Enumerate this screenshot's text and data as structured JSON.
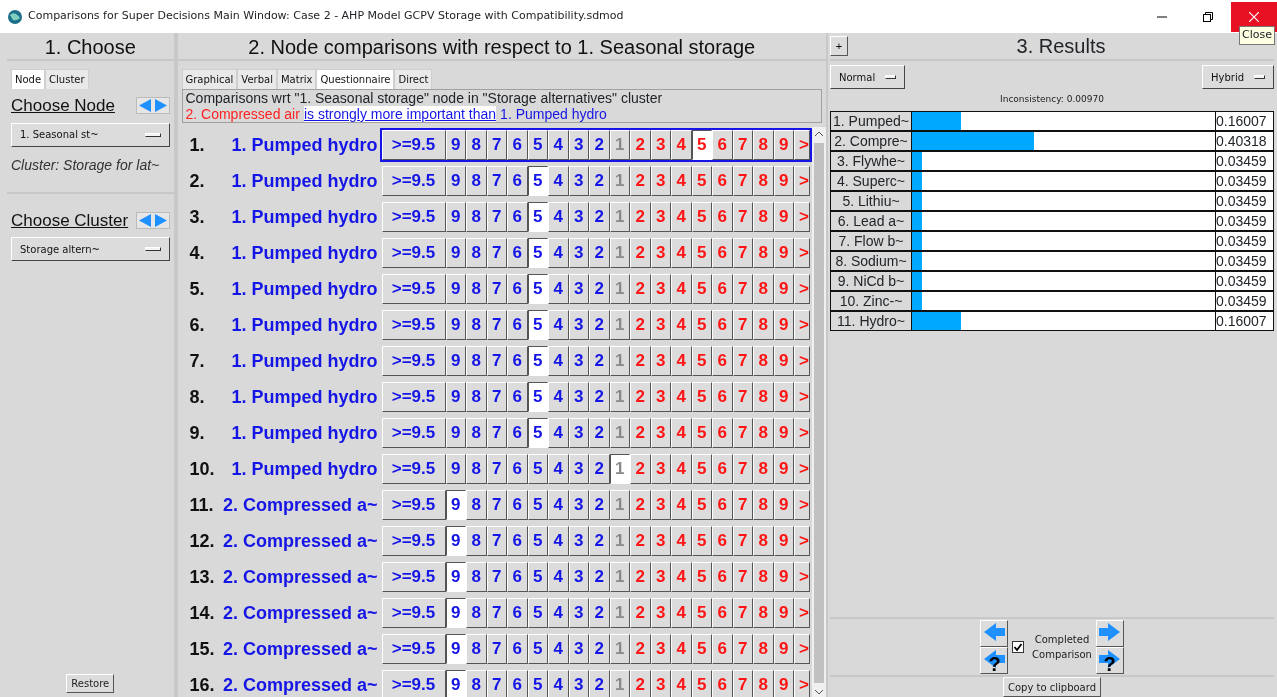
{
  "window": {
    "title": "Comparisons for Super Decisions Main Window: Case 2 - AHP Model GCPV Storage with Compatibility.sdmod",
    "tooltip": "Close"
  },
  "choose": {
    "title": "1. Choose",
    "tabs": [
      {
        "label": "Node",
        "selected": true
      },
      {
        "label": "Cluster",
        "selected": false
      }
    ],
    "node_heading": "Choose Node",
    "node_value": "1. Seasonal st~",
    "cluster_info": "Cluster: Storage for lat~",
    "cluster_heading": "Choose Cluster",
    "cluster_value": "Storage altern~",
    "restore": "Restore"
  },
  "comparisons": {
    "title": "2. Node comparisons with respect to 1. Seasonal storage",
    "tabs": [
      {
        "label": "Graphical",
        "selected": false
      },
      {
        "label": "Verbal",
        "selected": false
      },
      {
        "label": "Matrix",
        "selected": false
      },
      {
        "label": "Questionnaire",
        "selected": true
      },
      {
        "label": "Direct",
        "selected": false
      }
    ],
    "description": "Comparisons wrt \"1. Seasonal storage\" node in \"Storage alternatives\" cluster",
    "judgment": {
      "winner": "2. Compressed air",
      "phrase": "is strongly more important than",
      "loser": "1. Pumped hydro"
    },
    "rows": [
      {
        "number": "1.",
        "item": "1. Pumped hydro",
        "active": true,
        "cells": [
          {
            "text": ">=9.5",
            "kind": "top",
            "selected": false
          },
          {
            "text": "9",
            "kind": "left",
            "selected": false
          },
          {
            "text": "8",
            "kind": "left",
            "selected": false
          },
          {
            "text": "7",
            "kind": "left",
            "selected": false
          },
          {
            "text": "6",
            "kind": "left",
            "selected": false
          },
          {
            "text": "5",
            "kind": "left",
            "selected": false
          },
          {
            "text": "4",
            "kind": "left",
            "selected": false
          },
          {
            "text": "3",
            "kind": "left",
            "selected": false
          },
          {
            "text": "2",
            "kind": "left",
            "selected": false
          },
          {
            "text": "1",
            "kind": "equal",
            "selected": false
          },
          {
            "text": "2",
            "kind": "right",
            "selected": false
          },
          {
            "text": "3",
            "kind": "right",
            "selected": false
          },
          {
            "text": "4",
            "kind": "right",
            "selected": false
          },
          {
            "text": "5",
            "kind": "right",
            "selected": true
          },
          {
            "text": "6",
            "kind": "right",
            "selected": false
          },
          {
            "text": "7",
            "kind": "right",
            "selected": false
          },
          {
            "text": "8",
            "kind": "right",
            "selected": false
          },
          {
            "text": "9",
            "kind": "right",
            "selected": false
          },
          {
            "text": ">",
            "kind": "more",
            "selected": false
          }
        ]
      },
      {
        "number": "2.",
        "item": "1. Pumped hydro",
        "active": false,
        "cells": [
          {
            "text": ">=9.5",
            "kind": "top",
            "selected": false
          },
          {
            "text": "9",
            "kind": "left",
            "selected": false
          },
          {
            "text": "8",
            "kind": "left",
            "selected": false
          },
          {
            "text": "7",
            "kind": "left",
            "selected": false
          },
          {
            "text": "6",
            "kind": "left",
            "selected": false
          },
          {
            "text": "5",
            "kind": "left",
            "selected": true
          },
          {
            "text": "4",
            "kind": "left",
            "selected": false
          },
          {
            "text": "3",
            "kind": "left",
            "selected": false
          },
          {
            "text": "2",
            "kind": "left",
            "selected": false
          },
          {
            "text": "1",
            "kind": "equal",
            "selected": false
          },
          {
            "text": "2",
            "kind": "right",
            "selected": false
          },
          {
            "text": "3",
            "kind": "right",
            "selected": false
          },
          {
            "text": "4",
            "kind": "right",
            "selected": false
          },
          {
            "text": "5",
            "kind": "right",
            "selected": false
          },
          {
            "text": "6",
            "kind": "right",
            "selected": false
          },
          {
            "text": "7",
            "kind": "right",
            "selected": false
          },
          {
            "text": "8",
            "kind": "right",
            "selected": false
          },
          {
            "text": "9",
            "kind": "right",
            "selected": false
          },
          {
            "text": ">",
            "kind": "more",
            "selected": false
          }
        ]
      },
      {
        "number": "3.",
        "item": "1. Pumped hydro",
        "active": false,
        "cells": [
          {
            "text": ">=9.5",
            "kind": "top",
            "selected": false
          },
          {
            "text": "9",
            "kind": "left",
            "selected": false
          },
          {
            "text": "8",
            "kind": "left",
            "selected": false
          },
          {
            "text": "7",
            "kind": "left",
            "selected": false
          },
          {
            "text": "6",
            "kind": "left",
            "selected": false
          },
          {
            "text": "5",
            "kind": "left",
            "selected": true
          },
          {
            "text": "4",
            "kind": "left",
            "selected": false
          },
          {
            "text": "3",
            "kind": "left",
            "selected": false
          },
          {
            "text": "2",
            "kind": "left",
            "selected": false
          },
          {
            "text": "1",
            "kind": "equal",
            "selected": false
          },
          {
            "text": "2",
            "kind": "right",
            "selected": false
          },
          {
            "text": "3",
            "kind": "right",
            "selected": false
          },
          {
            "text": "4",
            "kind": "right",
            "selected": false
          },
          {
            "text": "5",
            "kind": "right",
            "selected": false
          },
          {
            "text": "6",
            "kind": "right",
            "selected": false
          },
          {
            "text": "7",
            "kind": "right",
            "selected": false
          },
          {
            "text": "8",
            "kind": "right",
            "selected": false
          },
          {
            "text": "9",
            "kind": "right",
            "selected": false
          },
          {
            "text": ">",
            "kind": "more",
            "selected": false
          }
        ]
      },
      {
        "number": "4.",
        "item": "1. Pumped hydro",
        "active": false,
        "cells": [
          {
            "text": ">=9.5",
            "kind": "top",
            "selected": false
          },
          {
            "text": "9",
            "kind": "left",
            "selected": false
          },
          {
            "text": "8",
            "kind": "left",
            "selected": false
          },
          {
            "text": "7",
            "kind": "left",
            "selected": false
          },
          {
            "text": "6",
            "kind": "left",
            "selected": false
          },
          {
            "text": "5",
            "kind": "left",
            "selected": true
          },
          {
            "text": "4",
            "kind": "left",
            "selected": false
          },
          {
            "text": "3",
            "kind": "left",
            "selected": false
          },
          {
            "text": "2",
            "kind": "left",
            "selected": false
          },
          {
            "text": "1",
            "kind": "equal",
            "selected": false
          },
          {
            "text": "2",
            "kind": "right",
            "selected": false
          },
          {
            "text": "3",
            "kind": "right",
            "selected": false
          },
          {
            "text": "4",
            "kind": "right",
            "selected": false
          },
          {
            "text": "5",
            "kind": "right",
            "selected": false
          },
          {
            "text": "6",
            "kind": "right",
            "selected": false
          },
          {
            "text": "7",
            "kind": "right",
            "selected": false
          },
          {
            "text": "8",
            "kind": "right",
            "selected": false
          },
          {
            "text": "9",
            "kind": "right",
            "selected": false
          },
          {
            "text": ">",
            "kind": "more",
            "selected": false
          }
        ]
      },
      {
        "number": "5.",
        "item": "1. Pumped hydro",
        "active": false,
        "cells": [
          {
            "text": ">=9.5",
            "kind": "top",
            "selected": false
          },
          {
            "text": "9",
            "kind": "left",
            "selected": false
          },
          {
            "text": "8",
            "kind": "left",
            "selected": false
          },
          {
            "text": "7",
            "kind": "left",
            "selected": false
          },
          {
            "text": "6",
            "kind": "left",
            "selected": false
          },
          {
            "text": "5",
            "kind": "left",
            "selected": true
          },
          {
            "text": "4",
            "kind": "left",
            "selected": false
          },
          {
            "text": "3",
            "kind": "left",
            "selected": false
          },
          {
            "text": "2",
            "kind": "left",
            "selected": false
          },
          {
            "text": "1",
            "kind": "equal",
            "selected": false
          },
          {
            "text": "2",
            "kind": "right",
            "selected": false
          },
          {
            "text": "3",
            "kind": "right",
            "selected": false
          },
          {
            "text": "4",
            "kind": "right",
            "selected": false
          },
          {
            "text": "5",
            "kind": "right",
            "selected": false
          },
          {
            "text": "6",
            "kind": "right",
            "selected": false
          },
          {
            "text": "7",
            "kind": "right",
            "selected": false
          },
          {
            "text": "8",
            "kind": "right",
            "selected": false
          },
          {
            "text": "9",
            "kind": "right",
            "selected": false
          },
          {
            "text": ">",
            "kind": "more",
            "selected": false
          }
        ]
      },
      {
        "number": "6.",
        "item": "1. Pumped hydro",
        "active": false,
        "cells": [
          {
            "text": ">=9.5",
            "kind": "top",
            "selected": false
          },
          {
            "text": "9",
            "kind": "left",
            "selected": false
          },
          {
            "text": "8",
            "kind": "left",
            "selected": false
          },
          {
            "text": "7",
            "kind": "left",
            "selected": false
          },
          {
            "text": "6",
            "kind": "left",
            "selected": false
          },
          {
            "text": "5",
            "kind": "left",
            "selected": true
          },
          {
            "text": "4",
            "kind": "left",
            "selected": false
          },
          {
            "text": "3",
            "kind": "left",
            "selected": false
          },
          {
            "text": "2",
            "kind": "left",
            "selected": false
          },
          {
            "text": "1",
            "kind": "equal",
            "selected": false
          },
          {
            "text": "2",
            "kind": "right",
            "selected": false
          },
          {
            "text": "3",
            "kind": "right",
            "selected": false
          },
          {
            "text": "4",
            "kind": "right",
            "selected": false
          },
          {
            "text": "5",
            "kind": "right",
            "selected": false
          },
          {
            "text": "6",
            "kind": "right",
            "selected": false
          },
          {
            "text": "7",
            "kind": "right",
            "selected": false
          },
          {
            "text": "8",
            "kind": "right",
            "selected": false
          },
          {
            "text": "9",
            "kind": "right",
            "selected": false
          },
          {
            "text": ">",
            "kind": "more",
            "selected": false
          }
        ]
      },
      {
        "number": "7.",
        "item": "1. Pumped hydro",
        "active": false,
        "cells": [
          {
            "text": ">=9.5",
            "kind": "top",
            "selected": false
          },
          {
            "text": "9",
            "kind": "left",
            "selected": false
          },
          {
            "text": "8",
            "kind": "left",
            "selected": false
          },
          {
            "text": "7",
            "kind": "left",
            "selected": false
          },
          {
            "text": "6",
            "kind": "left",
            "selected": false
          },
          {
            "text": "5",
            "kind": "left",
            "selected": true
          },
          {
            "text": "4",
            "kind": "left",
            "selected": false
          },
          {
            "text": "3",
            "kind": "left",
            "selected": false
          },
          {
            "text": "2",
            "kind": "left",
            "selected": false
          },
          {
            "text": "1",
            "kind": "equal",
            "selected": false
          },
          {
            "text": "2",
            "kind": "right",
            "selected": false
          },
          {
            "text": "3",
            "kind": "right",
            "selected": false
          },
          {
            "text": "4",
            "kind": "right",
            "selected": false
          },
          {
            "text": "5",
            "kind": "right",
            "selected": false
          },
          {
            "text": "6",
            "kind": "right",
            "selected": false
          },
          {
            "text": "7",
            "kind": "right",
            "selected": false
          },
          {
            "text": "8",
            "kind": "right",
            "selected": false
          },
          {
            "text": "9",
            "kind": "right",
            "selected": false
          },
          {
            "text": ">",
            "kind": "more",
            "selected": false
          }
        ]
      },
      {
        "number": "8.",
        "item": "1. Pumped hydro",
        "active": false,
        "cells": [
          {
            "text": ">=9.5",
            "kind": "top",
            "selected": false
          },
          {
            "text": "9",
            "kind": "left",
            "selected": false
          },
          {
            "text": "8",
            "kind": "left",
            "selected": false
          },
          {
            "text": "7",
            "kind": "left",
            "selected": false
          },
          {
            "text": "6",
            "kind": "left",
            "selected": false
          },
          {
            "text": "5",
            "kind": "left",
            "selected": true
          },
          {
            "text": "4",
            "kind": "left",
            "selected": false
          },
          {
            "text": "3",
            "kind": "left",
            "selected": false
          },
          {
            "text": "2",
            "kind": "left",
            "selected": false
          },
          {
            "text": "1",
            "kind": "equal",
            "selected": false
          },
          {
            "text": "2",
            "kind": "right",
            "selected": false
          },
          {
            "text": "3",
            "kind": "right",
            "selected": false
          },
          {
            "text": "4",
            "kind": "right",
            "selected": false
          },
          {
            "text": "5",
            "kind": "right",
            "selected": false
          },
          {
            "text": "6",
            "kind": "right",
            "selected": false
          },
          {
            "text": "7",
            "kind": "right",
            "selected": false
          },
          {
            "text": "8",
            "kind": "right",
            "selected": false
          },
          {
            "text": "9",
            "kind": "right",
            "selected": false
          },
          {
            "text": ">",
            "kind": "more",
            "selected": false
          }
        ]
      },
      {
        "number": "9.",
        "item": "1. Pumped hydro",
        "active": false,
        "cells": [
          {
            "text": ">=9.5",
            "kind": "top",
            "selected": false
          },
          {
            "text": "9",
            "kind": "left",
            "selected": false
          },
          {
            "text": "8",
            "kind": "left",
            "selected": false
          },
          {
            "text": "7",
            "kind": "left",
            "selected": false
          },
          {
            "text": "6",
            "kind": "left",
            "selected": false
          },
          {
            "text": "5",
            "kind": "left",
            "selected": true
          },
          {
            "text": "4",
            "kind": "left",
            "selected": false
          },
          {
            "text": "3",
            "kind": "left",
            "selected": false
          },
          {
            "text": "2",
            "kind": "left",
            "selected": false
          },
          {
            "text": "1",
            "kind": "equal",
            "selected": false
          },
          {
            "text": "2",
            "kind": "right",
            "selected": false
          },
          {
            "text": "3",
            "kind": "right",
            "selected": false
          },
          {
            "text": "4",
            "kind": "right",
            "selected": false
          },
          {
            "text": "5",
            "kind": "right",
            "selected": false
          },
          {
            "text": "6",
            "kind": "right",
            "selected": false
          },
          {
            "text": "7",
            "kind": "right",
            "selected": false
          },
          {
            "text": "8",
            "kind": "right",
            "selected": false
          },
          {
            "text": "9",
            "kind": "right",
            "selected": false
          },
          {
            "text": ">",
            "kind": "more",
            "selected": false
          }
        ]
      },
      {
        "number": "10.",
        "item": "1. Pumped hydro",
        "active": false,
        "cells": [
          {
            "text": ">=9.5",
            "kind": "top",
            "selected": false
          },
          {
            "text": "9",
            "kind": "left",
            "selected": false
          },
          {
            "text": "8",
            "kind": "left",
            "selected": false
          },
          {
            "text": "7",
            "kind": "left",
            "selected": false
          },
          {
            "text": "6",
            "kind": "left",
            "selected": false
          },
          {
            "text": "5",
            "kind": "left",
            "selected": false
          },
          {
            "text": "4",
            "kind": "left",
            "selected": false
          },
          {
            "text": "3",
            "kind": "left",
            "selected": false
          },
          {
            "text": "2",
            "kind": "left",
            "selected": false
          },
          {
            "text": "1",
            "kind": "equal",
            "selected": true
          },
          {
            "text": "2",
            "kind": "right",
            "selected": false
          },
          {
            "text": "3",
            "kind": "right",
            "selected": false
          },
          {
            "text": "4",
            "kind": "right",
            "selected": false
          },
          {
            "text": "5",
            "kind": "right",
            "selected": false
          },
          {
            "text": "6",
            "kind": "right",
            "selected": false
          },
          {
            "text": "7",
            "kind": "right",
            "selected": false
          },
          {
            "text": "8",
            "kind": "right",
            "selected": false
          },
          {
            "text": "9",
            "kind": "right",
            "selected": false
          },
          {
            "text": ">",
            "kind": "more",
            "selected": false
          }
        ]
      },
      {
        "number": "11.",
        "item": "2. Compressed a~",
        "active": false,
        "cells": [
          {
            "text": ">=9.5",
            "kind": "top",
            "selected": false
          },
          {
            "text": "9",
            "kind": "left",
            "selected": true
          },
          {
            "text": "8",
            "kind": "left",
            "selected": false
          },
          {
            "text": "7",
            "kind": "left",
            "selected": false
          },
          {
            "text": "6",
            "kind": "left",
            "selected": false
          },
          {
            "text": "5",
            "kind": "left",
            "selected": false
          },
          {
            "text": "4",
            "kind": "left",
            "selected": false
          },
          {
            "text": "3",
            "kind": "left",
            "selected": false
          },
          {
            "text": "2",
            "kind": "left",
            "selected": false
          },
          {
            "text": "1",
            "kind": "equal",
            "selected": false
          },
          {
            "text": "2",
            "kind": "right",
            "selected": false
          },
          {
            "text": "3",
            "kind": "right",
            "selected": false
          },
          {
            "text": "4",
            "kind": "right",
            "selected": false
          },
          {
            "text": "5",
            "kind": "right",
            "selected": false
          },
          {
            "text": "6",
            "kind": "right",
            "selected": false
          },
          {
            "text": "7",
            "kind": "right",
            "selected": false
          },
          {
            "text": "8",
            "kind": "right",
            "selected": false
          },
          {
            "text": "9",
            "kind": "right",
            "selected": false
          },
          {
            "text": ">",
            "kind": "more",
            "selected": false
          }
        ]
      },
      {
        "number": "12.",
        "item": "2. Compressed a~",
        "active": false,
        "cells": [
          {
            "text": ">=9.5",
            "kind": "top",
            "selected": false
          },
          {
            "text": "9",
            "kind": "left",
            "selected": true
          },
          {
            "text": "8",
            "kind": "left",
            "selected": false
          },
          {
            "text": "7",
            "kind": "left",
            "selected": false
          },
          {
            "text": "6",
            "kind": "left",
            "selected": false
          },
          {
            "text": "5",
            "kind": "left",
            "selected": false
          },
          {
            "text": "4",
            "kind": "left",
            "selected": false
          },
          {
            "text": "3",
            "kind": "left",
            "selected": false
          },
          {
            "text": "2",
            "kind": "left",
            "selected": false
          },
          {
            "text": "1",
            "kind": "equal",
            "selected": false
          },
          {
            "text": "2",
            "kind": "right",
            "selected": false
          },
          {
            "text": "3",
            "kind": "right",
            "selected": false
          },
          {
            "text": "4",
            "kind": "right",
            "selected": false
          },
          {
            "text": "5",
            "kind": "right",
            "selected": false
          },
          {
            "text": "6",
            "kind": "right",
            "selected": false
          },
          {
            "text": "7",
            "kind": "right",
            "selected": false
          },
          {
            "text": "8",
            "kind": "right",
            "selected": false
          },
          {
            "text": "9",
            "kind": "right",
            "selected": false
          },
          {
            "text": ">",
            "kind": "more",
            "selected": false
          }
        ]
      },
      {
        "number": "13.",
        "item": "2. Compressed a~",
        "active": false,
        "cells": [
          {
            "text": ">=9.5",
            "kind": "top",
            "selected": false
          },
          {
            "text": "9",
            "kind": "left",
            "selected": true
          },
          {
            "text": "8",
            "kind": "left",
            "selected": false
          },
          {
            "text": "7",
            "kind": "left",
            "selected": false
          },
          {
            "text": "6",
            "kind": "left",
            "selected": false
          },
          {
            "text": "5",
            "kind": "left",
            "selected": false
          },
          {
            "text": "4",
            "kind": "left",
            "selected": false
          },
          {
            "text": "3",
            "kind": "left",
            "selected": false
          },
          {
            "text": "2",
            "kind": "left",
            "selected": false
          },
          {
            "text": "1",
            "kind": "equal",
            "selected": false
          },
          {
            "text": "2",
            "kind": "right",
            "selected": false
          },
          {
            "text": "3",
            "kind": "right",
            "selected": false
          },
          {
            "text": "4",
            "kind": "right",
            "selected": false
          },
          {
            "text": "5",
            "kind": "right",
            "selected": false
          },
          {
            "text": "6",
            "kind": "right",
            "selected": false
          },
          {
            "text": "7",
            "kind": "right",
            "selected": false
          },
          {
            "text": "8",
            "kind": "right",
            "selected": false
          },
          {
            "text": "9",
            "kind": "right",
            "selected": false
          },
          {
            "text": ">",
            "kind": "more",
            "selected": false
          }
        ]
      },
      {
        "number": "14.",
        "item": "2. Compressed a~",
        "active": false,
        "cells": [
          {
            "text": ">=9.5",
            "kind": "top",
            "selected": false
          },
          {
            "text": "9",
            "kind": "left",
            "selected": true
          },
          {
            "text": "8",
            "kind": "left",
            "selected": false
          },
          {
            "text": "7",
            "kind": "left",
            "selected": false
          },
          {
            "text": "6",
            "kind": "left",
            "selected": false
          },
          {
            "text": "5",
            "kind": "left",
            "selected": false
          },
          {
            "text": "4",
            "kind": "left",
            "selected": false
          },
          {
            "text": "3",
            "kind": "left",
            "selected": false
          },
          {
            "text": "2",
            "kind": "left",
            "selected": false
          },
          {
            "text": "1",
            "kind": "equal",
            "selected": false
          },
          {
            "text": "2",
            "kind": "right",
            "selected": false
          },
          {
            "text": "3",
            "kind": "right",
            "selected": false
          },
          {
            "text": "4",
            "kind": "right",
            "selected": false
          },
          {
            "text": "5",
            "kind": "right",
            "selected": false
          },
          {
            "text": "6",
            "kind": "right",
            "selected": false
          },
          {
            "text": "7",
            "kind": "right",
            "selected": false
          },
          {
            "text": "8",
            "kind": "right",
            "selected": false
          },
          {
            "text": "9",
            "kind": "right",
            "selected": false
          },
          {
            "text": ">",
            "kind": "more",
            "selected": false
          }
        ]
      },
      {
        "number": "15.",
        "item": "2. Compressed a~",
        "active": false,
        "cells": [
          {
            "text": ">=9.5",
            "kind": "top",
            "selected": false
          },
          {
            "text": "9",
            "kind": "left",
            "selected": true
          },
          {
            "text": "8",
            "kind": "left",
            "selected": false
          },
          {
            "text": "7",
            "kind": "left",
            "selected": false
          },
          {
            "text": "6",
            "kind": "left",
            "selected": false
          },
          {
            "text": "5",
            "kind": "left",
            "selected": false
          },
          {
            "text": "4",
            "kind": "left",
            "selected": false
          },
          {
            "text": "3",
            "kind": "left",
            "selected": false
          },
          {
            "text": "2",
            "kind": "left",
            "selected": false
          },
          {
            "text": "1",
            "kind": "equal",
            "selected": false
          },
          {
            "text": "2",
            "kind": "right",
            "selected": false
          },
          {
            "text": "3",
            "kind": "right",
            "selected": false
          },
          {
            "text": "4",
            "kind": "right",
            "selected": false
          },
          {
            "text": "5",
            "kind": "right",
            "selected": false
          },
          {
            "text": "6",
            "kind": "right",
            "selected": false
          },
          {
            "text": "7",
            "kind": "right",
            "selected": false
          },
          {
            "text": "8",
            "kind": "right",
            "selected": false
          },
          {
            "text": "9",
            "kind": "right",
            "selected": false
          },
          {
            "text": ">",
            "kind": "more",
            "selected": false
          }
        ]
      },
      {
        "number": "16.",
        "item": "2. Compressed a~",
        "active": false,
        "cells": [
          {
            "text": ">=9.5",
            "kind": "top",
            "selected": false
          },
          {
            "text": "9",
            "kind": "left",
            "selected": true
          },
          {
            "text": "8",
            "kind": "left",
            "selected": false
          },
          {
            "text": "7",
            "kind": "left",
            "selected": false
          },
          {
            "text": "6",
            "kind": "left",
            "selected": false
          },
          {
            "text": "5",
            "kind": "left",
            "selected": false
          },
          {
            "text": "4",
            "kind": "left",
            "selected": false
          },
          {
            "text": "3",
            "kind": "left",
            "selected": false
          },
          {
            "text": "2",
            "kind": "left",
            "selected": false
          },
          {
            "text": "1",
            "kind": "equal",
            "selected": false
          },
          {
            "text": "2",
            "kind": "right",
            "selected": false
          },
          {
            "text": "3",
            "kind": "right",
            "selected": false
          },
          {
            "text": "4",
            "kind": "right",
            "selected": false
          },
          {
            "text": "5",
            "kind": "right",
            "selected": false
          },
          {
            "text": "6",
            "kind": "right",
            "selected": false
          },
          {
            "text": "7",
            "kind": "right",
            "selected": false
          },
          {
            "text": "8",
            "kind": "right",
            "selected": false
          },
          {
            "text": "9",
            "kind": "right",
            "selected": false
          },
          {
            "text": ">",
            "kind": "more",
            "selected": false
          }
        ]
      }
    ]
  },
  "results": {
    "expand": "+",
    "title": "3. Results",
    "mode": "Normal",
    "method": "Hybrid",
    "inconsistency": "Inconsistency: 0.00970",
    "rows": [
      {
        "name": "1. Pumped~",
        "level": 0.16007,
        "value": "0.16007"
      },
      {
        "name": "2. Compre~",
        "level": 0.40318,
        "value": "0.40318"
      },
      {
        "name": "3. Flywhe~",
        "level": 0.03459,
        "value": "0.03459"
      },
      {
        "name": "4. Superc~",
        "level": 0.03459,
        "value": "0.03459"
      },
      {
        "name": "5. Lithiu~",
        "level": 0.03459,
        "value": "0.03459"
      },
      {
        "name": "6. Lead a~",
        "level": 0.03459,
        "value": "0.03459"
      },
      {
        "name": "7. Flow b~",
        "level": 0.03459,
        "value": "0.03459"
      },
      {
        "name": "8. Sodium~",
        "level": 0.03459,
        "value": "0.03459"
      },
      {
        "name": "9. NiCd b~",
        "level": 0.03459,
        "value": "0.03459"
      },
      {
        "name": "10. Zinc-~",
        "level": 0.03459,
        "value": "0.03459"
      },
      {
        "name": "11. Hydro~",
        "level": 0.16007,
        "value": "0.16007"
      }
    ],
    "nav": [
      {
        "kind": "prev"
      },
      {
        "kind": "prev_unfinished",
        "mark": "?"
      },
      {
        "kind": "next"
      },
      {
        "kind": "next_unfinished",
        "mark": "?"
      }
    ],
    "completed": {
      "label_1": "Completed",
      "label_2": "Comparison",
      "checked": true
    },
    "copy": "Copy to clipboard"
  }
}
